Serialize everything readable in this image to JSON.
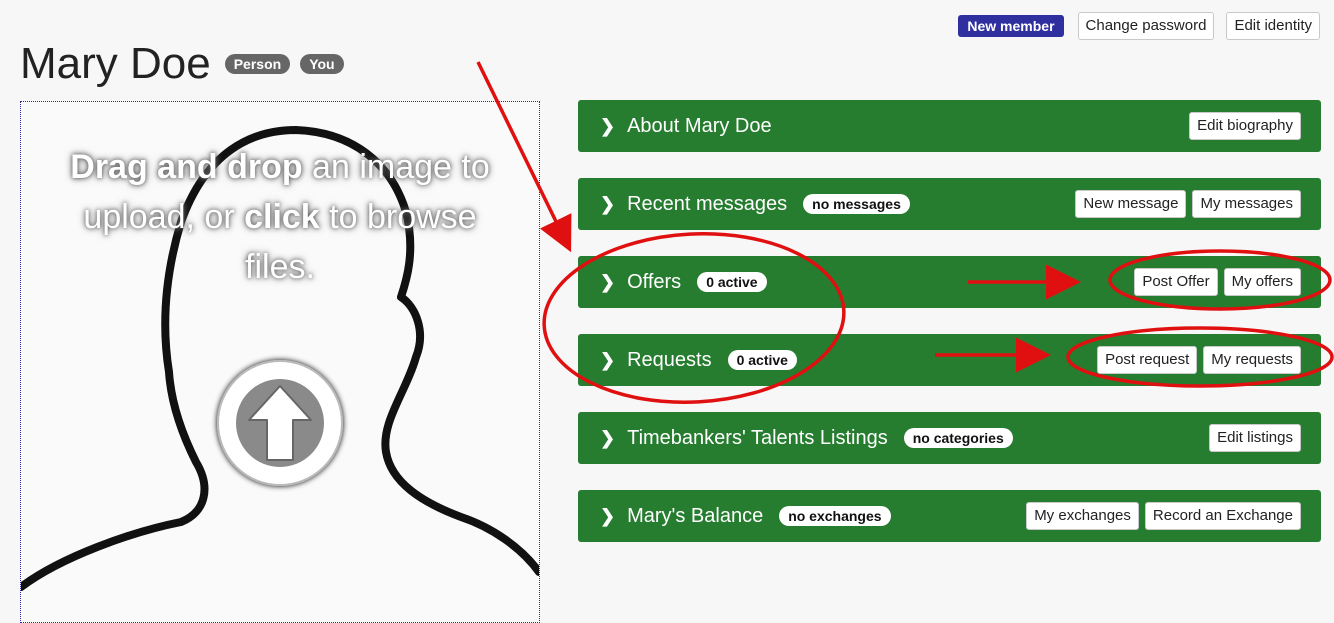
{
  "header": {
    "new_member": "New member",
    "change_password": "Change password",
    "edit_identity": "Edit identity"
  },
  "profile": {
    "name": "Mary Doe",
    "tag_person": "Person",
    "tag_you": "You"
  },
  "dropzone": {
    "bold1": "Drag and drop",
    "text1": " an image to upload, or ",
    "bold2": "click",
    "text2": " to browse files."
  },
  "panels": {
    "about": {
      "title": "About Mary Doe",
      "edit": "Edit biography"
    },
    "messages": {
      "title": "Recent messages",
      "badge": "no messages",
      "new": "New message",
      "mine": "My messages"
    },
    "offers": {
      "title": "Offers",
      "badge": "0 active",
      "post": "Post Offer",
      "mine": "My offers"
    },
    "requests": {
      "title": "Requests",
      "badge": "0 active",
      "post": "Post request",
      "mine": "My requests"
    },
    "talents": {
      "title": "Timebankers' Talents Listings",
      "badge": "no categories",
      "edit": "Edit listings"
    },
    "balance": {
      "title": "Mary's Balance",
      "badge": "no exchanges",
      "exchanges": "My exchanges",
      "record": "Record an Exchange"
    }
  },
  "colors": {
    "panel_green": "#267c2f",
    "new_member_blue": "#2f2f9f",
    "annotation_red": "#e01010"
  }
}
